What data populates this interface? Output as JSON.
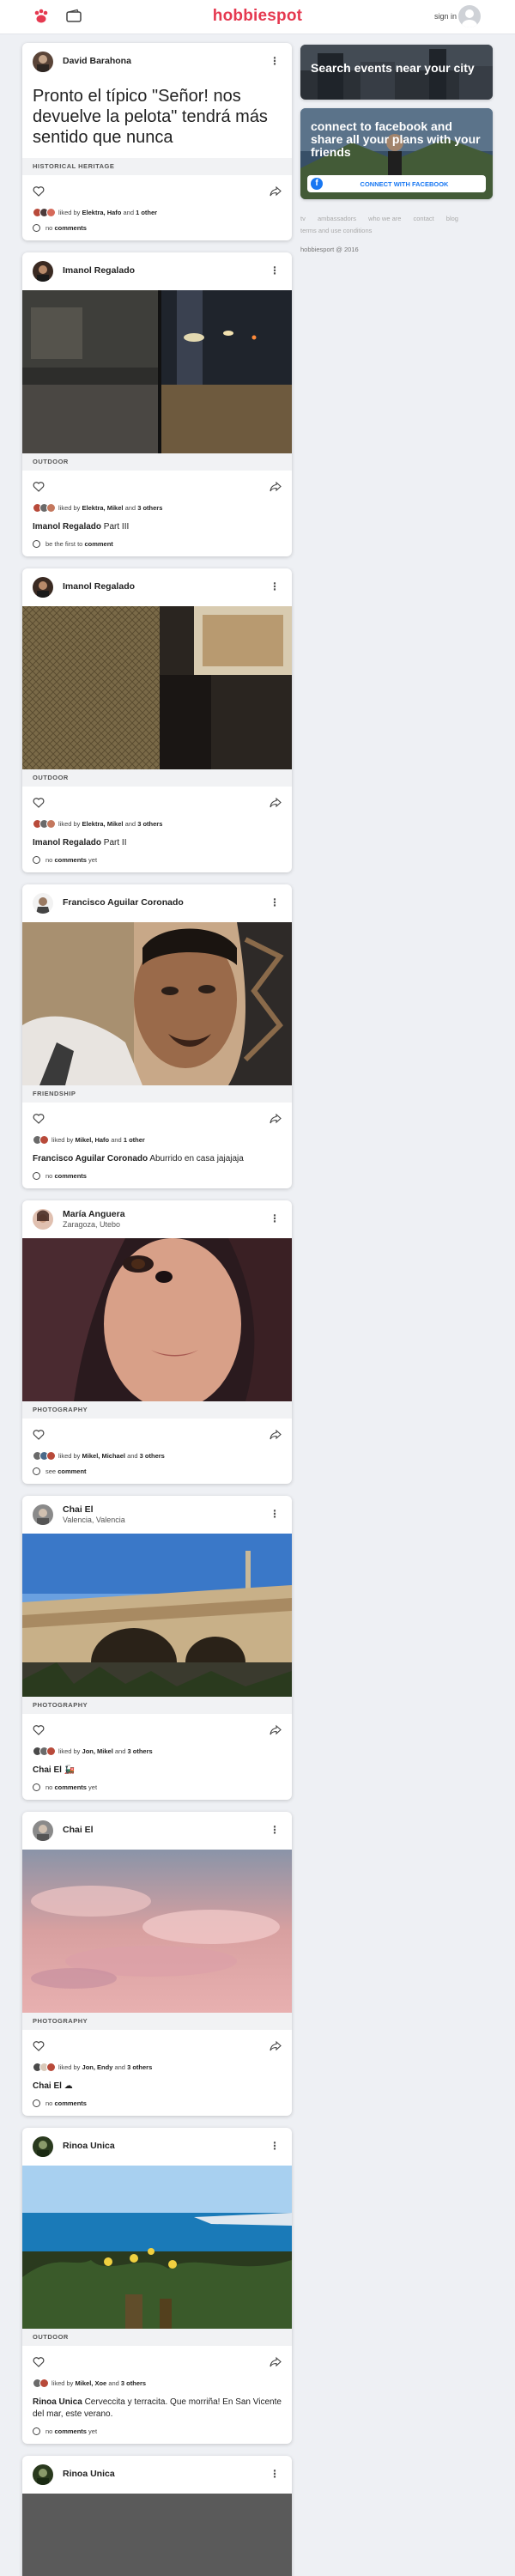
{
  "header": {
    "logo": "hobbiespot",
    "signin": "sign in"
  },
  "sidebar": {
    "events_title": "Search events near your city",
    "facebook_title": "connect to facebook and share all your plans with your friends",
    "facebook_button": "CONNECT WITH FACEBOOK",
    "links": [
      "tv",
      "ambassadors",
      "who we are",
      "contact",
      "blog",
      "terms and use conditions"
    ],
    "copyright": "hobbiesport @ 2016"
  },
  "posts": [
    {
      "author": "David Barahona",
      "headline": "Pronto el típico \"Señor! nos devuelve la pelota\" tendrá más sentido que nunca",
      "tag": "HISTORICAL HERITAGE",
      "likes_prefix": "liked by",
      "likes_names": "Elektra, Hafo",
      "likes_and": "and",
      "likes_more": "1 other",
      "comments_prefix": "no",
      "comments_word": "comments"
    },
    {
      "author": "Imanol Regalado",
      "tag": "OUTDOOR",
      "likes_prefix": "liked by",
      "likes_names": "Elektra, Mikel",
      "likes_and": "and",
      "likes_more": "3 others",
      "caption_author": "Imanol Regalado",
      "caption_text": "Part III",
      "comments_prefix": "be the first to",
      "comments_word": "comment"
    },
    {
      "author": "Imanol Regalado",
      "tag": "OUTDOOR",
      "likes_prefix": "liked by",
      "likes_names": "Elektra, Mikel",
      "likes_and": "and",
      "likes_more": "3 others",
      "caption_author": "Imanol Regalado",
      "caption_text": "Part II",
      "comments_prefix": "no",
      "comments_word": "comments",
      "comments_suffix": "yet"
    },
    {
      "author": "Francisco Aguilar Coronado",
      "tag": "FRIENDSHIP",
      "likes_prefix": "liked by",
      "likes_names": "Mikel, Hafo",
      "likes_and": "and",
      "likes_more": "1 other",
      "caption_author": "Francisco Aguilar Coronado",
      "caption_text": "Aburrido en casa jajajaja",
      "comments_prefix": "no",
      "comments_word": "comments"
    },
    {
      "author": "María Anguera",
      "location": "Zaragoza, Utebo",
      "tag": "PHOTOGRAPHY",
      "likes_prefix": "liked by",
      "likes_names": "Mikel, Michael",
      "likes_and": "and",
      "likes_more": "3 others",
      "comments_prefix": "see",
      "comments_word": "comment"
    },
    {
      "author": "Chai El",
      "location": "Valencia, Valencia",
      "tag": "PHOTOGRAPHY",
      "likes_prefix": "liked by",
      "likes_names": "Jon, Mikel",
      "likes_and": "and",
      "likes_more": "3 others",
      "caption_author": "Chai El",
      "caption_text": "🚂",
      "comments_prefix": "no",
      "comments_word": "comments",
      "comments_suffix": "yet"
    },
    {
      "author": "Chai El",
      "tag": "PHOTOGRAPHY",
      "likes_prefix": "liked by",
      "likes_names": "Jon, Endy",
      "likes_and": "and",
      "likes_more": "3 others",
      "caption_author": "Chai El",
      "caption_text": "☁",
      "comments_prefix": "no",
      "comments_word": "comments"
    },
    {
      "author": "Rinoa Unica",
      "tag": "OUTDOOR",
      "likes_prefix": "liked by",
      "likes_names": "Mikel, Xoe",
      "likes_and": "and",
      "likes_more": "3 others",
      "caption_author": "Rinoa Unica",
      "caption_text": "Cerveccita y terracita. Que morriña! En San Vicente del mar, este verano.",
      "comments_prefix": "no",
      "comments_word": "comments",
      "comments_suffix": "yet"
    },
    {
      "author": "Rinoa Unica"
    }
  ],
  "colors": {
    "brand": "#e53950",
    "facebook": "#1877f2"
  }
}
